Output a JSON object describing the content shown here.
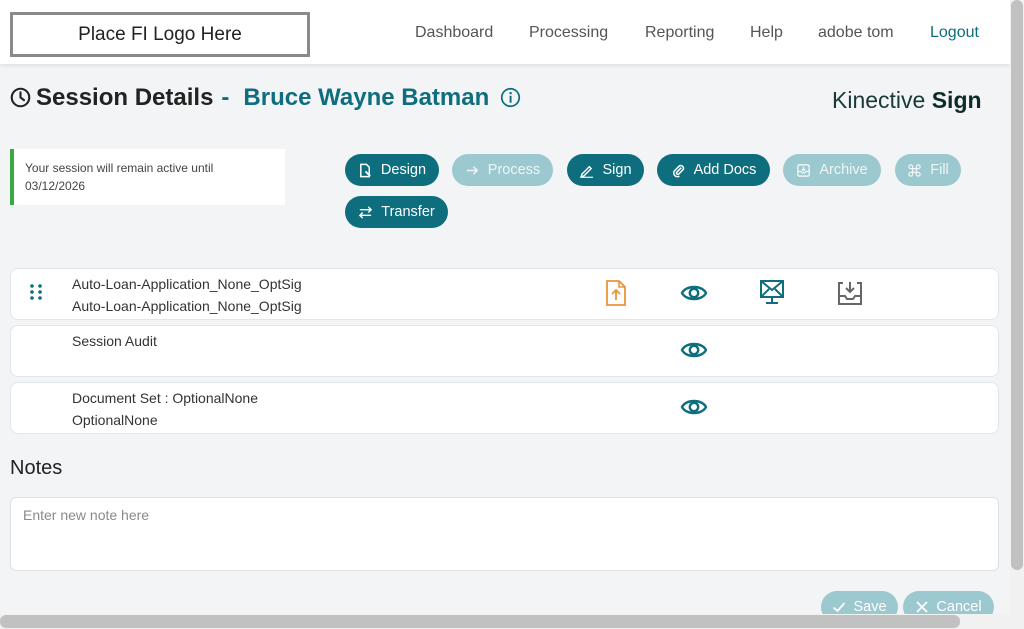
{
  "header": {
    "logo_text": "Place FI Logo Here",
    "nav": [
      {
        "label": "Dashboard"
      },
      {
        "label": "Processing"
      },
      {
        "label": "Reporting"
      },
      {
        "label": "Help"
      },
      {
        "label": "adobe tom"
      },
      {
        "label": "Logout"
      }
    ]
  },
  "title": {
    "label": "Session Details",
    "separator": "-",
    "customer": "Bruce Wayne Batman"
  },
  "brand": {
    "part1": "Kinective",
    "part2": "Sign"
  },
  "session_banner": {
    "text": "Your session will remain active until 03/12/2026"
  },
  "actions": [
    {
      "label": "Design",
      "enabled": true,
      "icon": "design-doc-icon"
    },
    {
      "label": "Process",
      "enabled": false,
      "icon": "arrow-right-icon"
    },
    {
      "label": "Sign",
      "enabled": true,
      "icon": "pen-icon"
    },
    {
      "label": "Add Docs",
      "enabled": true,
      "icon": "paperclip-icon"
    },
    {
      "label": "Archive",
      "enabled": false,
      "icon": "archive-icon"
    },
    {
      "label": "Fill",
      "enabled": false,
      "icon": "command-icon"
    },
    {
      "label": "Transfer",
      "enabled": true,
      "icon": "swap-arrows-icon"
    }
  ],
  "documents": [
    {
      "line1": "Auto-Loan-Application_None_OptSig",
      "line2": "Auto-Loan-Application_None_OptSig",
      "icons": [
        "upload-file-icon",
        "view-eye-icon",
        "monitor-envelope-icon",
        "inbox-download-icon"
      ]
    },
    {
      "line1": "Session Audit",
      "line2": "",
      "icons": [
        "view-eye-icon"
      ]
    },
    {
      "line1": "Document Set : OptionalNone",
      "line2": "OptionalNone",
      "icons": [
        "view-eye-icon"
      ]
    }
  ],
  "notes": {
    "title": "Notes",
    "placeholder": "Enter new note here"
  },
  "footer_buttons": {
    "save": "Save",
    "cancel": "Cancel"
  },
  "colors": {
    "accent": "#0f6e7e",
    "accent_disabled": "#9cc8cf",
    "session_bar": "#3aa843",
    "upload_icon": "#e8953a"
  }
}
